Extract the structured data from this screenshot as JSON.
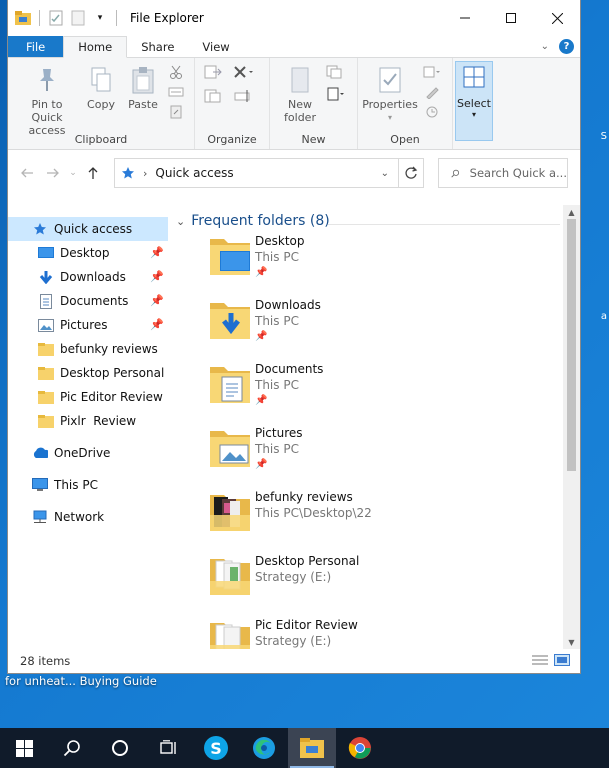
{
  "window": {
    "title": "File Explorer"
  },
  "tabs": [
    {
      "label": "File"
    },
    {
      "label": "Home"
    },
    {
      "label": "Share"
    },
    {
      "label": "View"
    }
  ],
  "ribbon": {
    "clipboard": {
      "label": "Clipboard",
      "pin_to_quick_access": "Pin to Quick access",
      "copy": "Copy",
      "paste": "Paste"
    },
    "organize": {
      "label": "Organize"
    },
    "new": {
      "label": "New",
      "new_folder": "New folder"
    },
    "open": {
      "label": "Open",
      "properties": "Properties"
    },
    "select": {
      "label": "Select"
    }
  },
  "address": {
    "location": "Quick access",
    "search_placeholder": "Search Quick a..."
  },
  "navpane": {
    "quick_access": "Quick access",
    "pinned": [
      {
        "label": "Desktop"
      },
      {
        "label": "Downloads"
      },
      {
        "label": "Documents"
      },
      {
        "label": "Pictures"
      }
    ],
    "recent": [
      {
        "label": "befunky reviews"
      },
      {
        "label": "Desktop Personal"
      },
      {
        "label": "Pic Editor Review"
      },
      {
        "label": "Pixlr  Review"
      }
    ],
    "onedrive": "OneDrive",
    "this_pc": "This PC",
    "network": "Network"
  },
  "frequent": {
    "heading": "Frequent folders (8)",
    "folders": [
      {
        "name": "Desktop",
        "location": "This PC"
      },
      {
        "name": "Downloads",
        "location": "This PC"
      },
      {
        "name": "Documents",
        "location": "This PC"
      },
      {
        "name": "Pictures",
        "location": "This PC"
      },
      {
        "name": "befunky reviews",
        "location": "This PC\\Desktop\\22"
      },
      {
        "name": "Desktop Personal",
        "location": "Strategy (E:)"
      },
      {
        "name": "Pic Editor Review",
        "location": "Strategy (E:)"
      }
    ]
  },
  "status": {
    "item_count": "28 items"
  },
  "desktop": {
    "icon_caption": "for unheat...  Buying Guide"
  },
  "colors": {
    "file_tab": "#1979ca",
    "selection": "#cce8ff",
    "taskbar": "#101b2a",
    "desktop": "#1479d0"
  }
}
